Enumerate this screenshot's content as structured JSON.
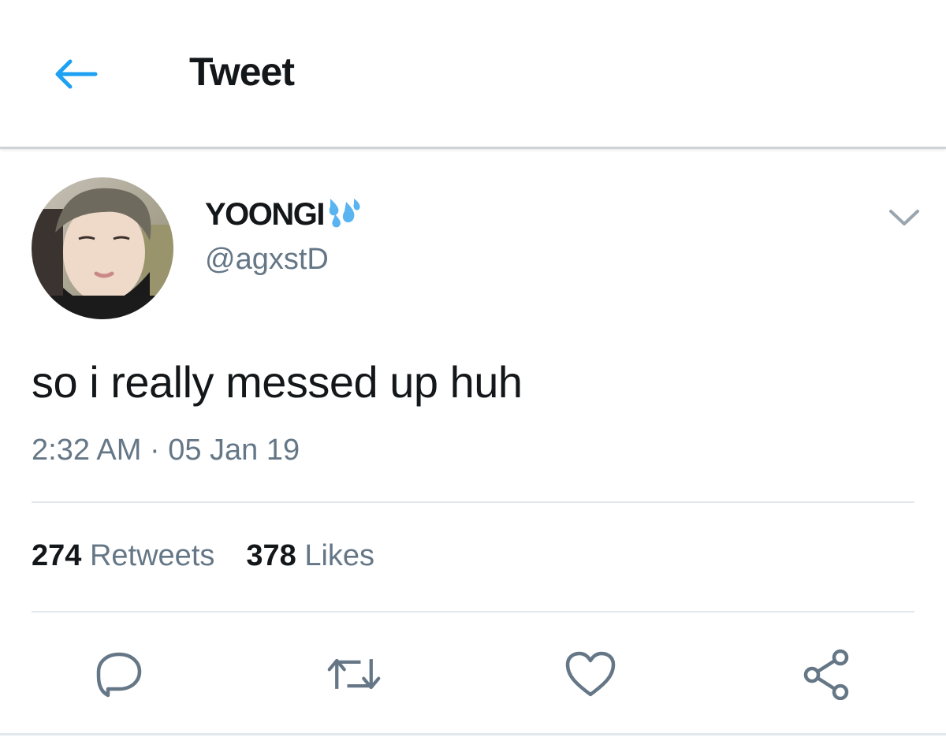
{
  "header": {
    "title": "Tweet",
    "back_icon": "arrow-left-icon"
  },
  "tweet": {
    "author_name": "YOONGI",
    "author_emoji": "sweat-droplets-icon",
    "handle": "@agxstD",
    "text": "so i really messed up huh",
    "time": "2:32 AM",
    "separator": "·",
    "date": "05 Jan 19",
    "menu_icon": "chevron-down-icon"
  },
  "stats": {
    "retweets_count": "274",
    "retweets_label": "Retweets",
    "likes_count": "378",
    "likes_label": "Likes"
  },
  "actions": [
    {
      "icon": "reply-icon"
    },
    {
      "icon": "retweet-icon"
    },
    {
      "icon": "heart-icon"
    },
    {
      "icon": "share-icon"
    }
  ],
  "colors": {
    "accent": "#1da1f2",
    "text": "#14171a",
    "secondary": "#657786",
    "divider": "#e1e8ed",
    "droplet": "#5ab4f0"
  }
}
